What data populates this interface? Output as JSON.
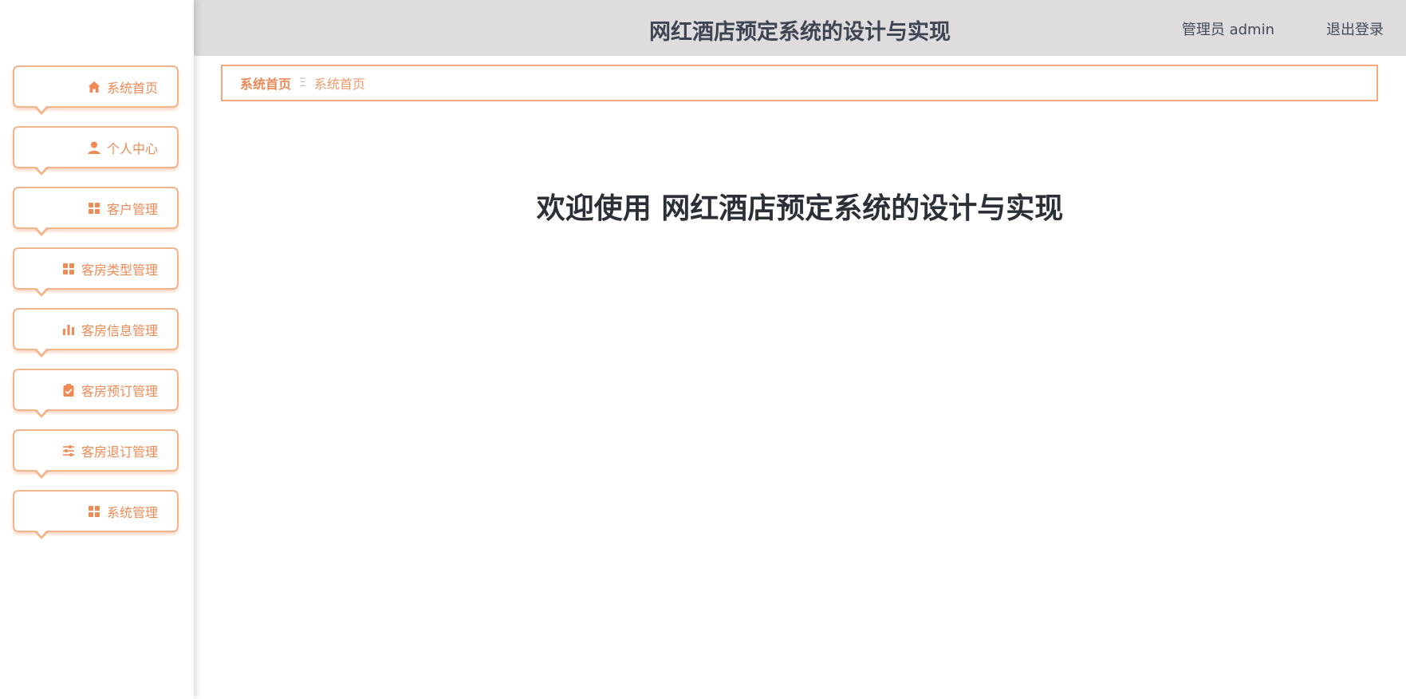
{
  "header": {
    "title": "网红酒店预定系统的设计与实现",
    "user": "管理员 admin",
    "logout": "退出登录"
  },
  "sidebar": {
    "items": [
      {
        "label": "系统首页",
        "icon": "home-icon"
      },
      {
        "label": "个人中心",
        "icon": "user-icon"
      },
      {
        "label": "客户管理",
        "icon": "grid-icon"
      },
      {
        "label": "客房类型管理",
        "icon": "grid-icon"
      },
      {
        "label": "客房信息管理",
        "icon": "bar-chart-icon"
      },
      {
        "label": "客房预订管理",
        "icon": "clipboard-check-icon"
      },
      {
        "label": "客房退订管理",
        "icon": "sliders-icon"
      },
      {
        "label": "系统管理",
        "icon": "grid-icon"
      }
    ]
  },
  "breadcrumb": {
    "first": "系统首页",
    "separator": "Ξ",
    "current": "系统首页"
  },
  "main": {
    "welcome": "欢迎使用 网红酒店预定系统的设计与实现"
  },
  "colors": {
    "accent": "#ee8a55",
    "border": "#f4b48c",
    "header_bg": "#dedcdd",
    "title_text": "#3f4453"
  }
}
